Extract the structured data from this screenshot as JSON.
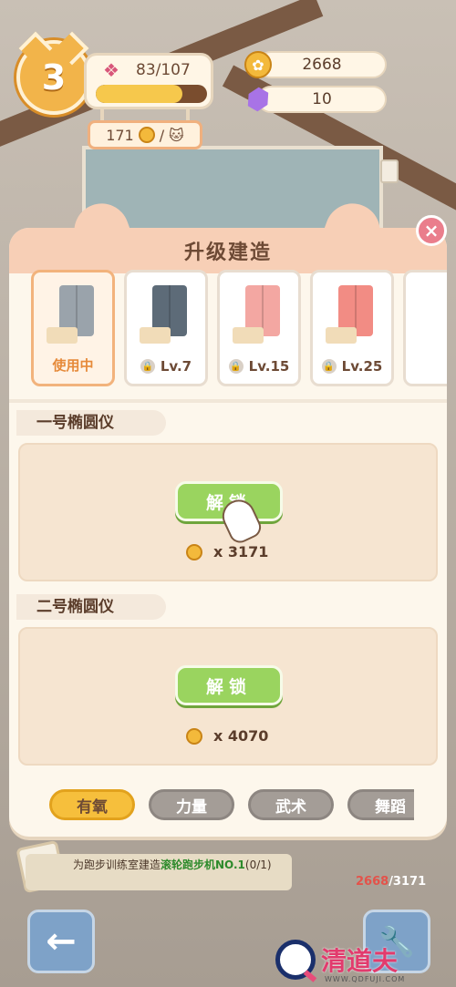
{
  "hud": {
    "level": "3",
    "xp_text": "83/107",
    "xp_progress": 0.78,
    "coin_subtext": "171",
    "coin_sep": "/",
    "paw_coins": "2668",
    "gems": "10"
  },
  "modal": {
    "title": "升级建造",
    "close_icon": "×",
    "skins": [
      {
        "label": "使用中",
        "locked": false,
        "active": true,
        "color": "#9aa3ab"
      },
      {
        "label": "Lv.7",
        "locked": true,
        "active": false,
        "color": "#5d6b78"
      },
      {
        "label": "Lv.15",
        "locked": true,
        "active": false,
        "color": "#f3a7a2"
      },
      {
        "label": "Lv.25",
        "locked": true,
        "active": false,
        "color": "#f28c84"
      }
    ],
    "sections": [
      {
        "title": "一号椭圆仪",
        "button": "解锁",
        "cost": "x 3171"
      },
      {
        "title": "二号椭圆仪",
        "button": "解锁",
        "cost": "x 4070"
      }
    ],
    "tabs": [
      "有氧",
      "力量",
      "武术",
      "舞蹈"
    ],
    "active_tab": 0
  },
  "task": {
    "prefix": "为跑步训练室建造",
    "highlight": "滚轮跑步机NO.1",
    "suffix": "(0/1)",
    "progress_current": "2668",
    "progress_total": "/3171"
  },
  "nav": {
    "back_icon": "←",
    "tool_icon": "🔧"
  },
  "watermark": {
    "text": "清道夫",
    "sub": "WWW.QDFUJI.COM"
  },
  "colors": {
    "accent_orange": "#f2b44a",
    "unlock_green": "#9ad45f",
    "modal_header": "#f7cfb6",
    "tab_active": "#f6bf3c"
  }
}
